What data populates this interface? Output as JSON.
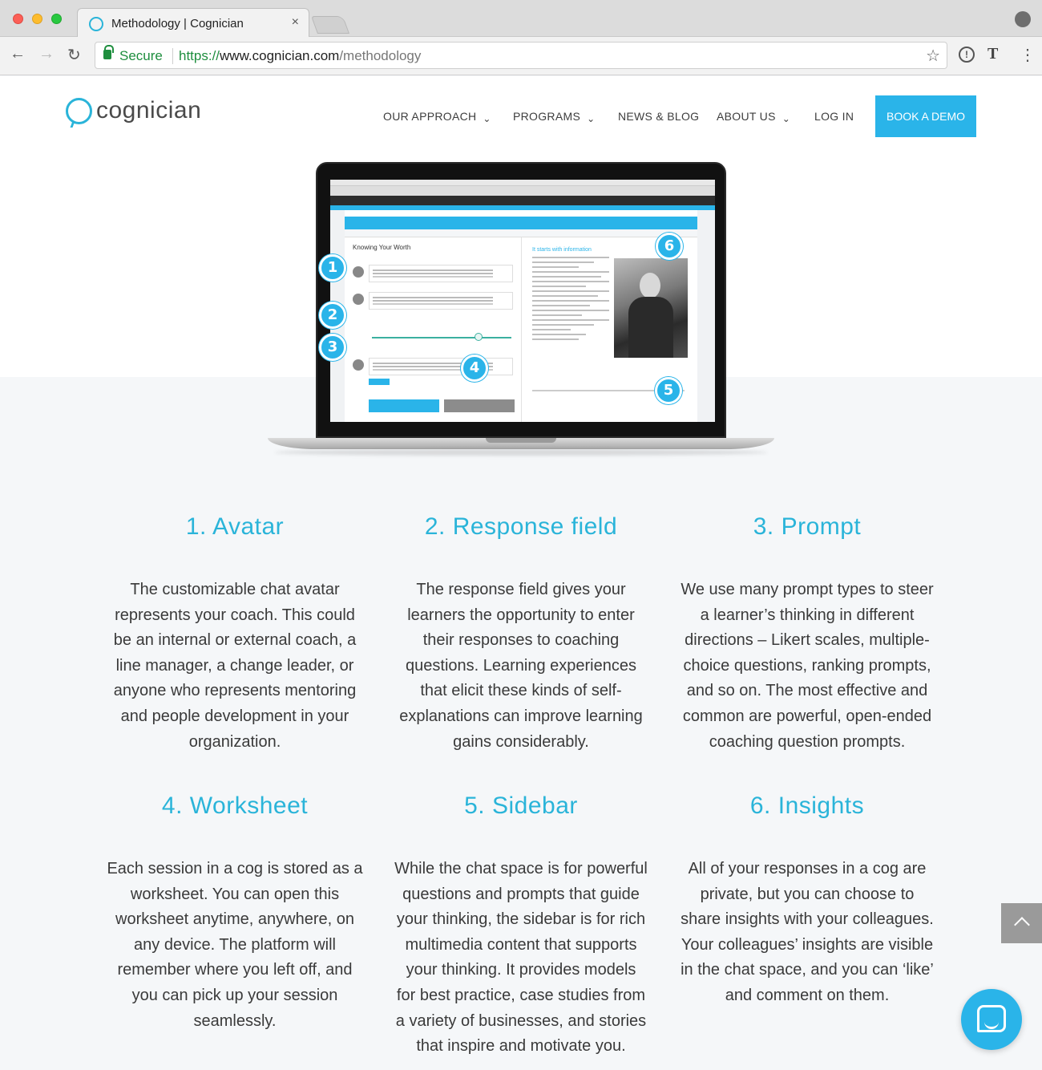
{
  "browser": {
    "tab_title": "Methodology | Cognician",
    "tab_close": "×",
    "secure_label": "Secure",
    "url_scheme": "https://",
    "url_host": "www.cognician.com",
    "url_path": "/methodology",
    "icons": [
      "back-icon",
      "forward-icon",
      "reload-icon",
      "lock-icon",
      "star-icon",
      "extension-icon",
      "menu-icon",
      "profile-icon"
    ]
  },
  "header": {
    "logo_text": "cognician",
    "nav": [
      {
        "label": "OUR APPROACH",
        "dropdown": true
      },
      {
        "label": "PROGRAMS",
        "dropdown": true
      },
      {
        "label": "NEWS & BLOG",
        "dropdown": false
      },
      {
        "label": "ABOUT US",
        "dropdown": true
      },
      {
        "label": "LOG IN",
        "dropdown": false
      }
    ],
    "cta": "BOOK A DEMO",
    "accent": "#2ab4e9"
  },
  "laptop": {
    "app_title": "Knowing Your Worth",
    "badges": [
      "1",
      "2",
      "3",
      "4",
      "5",
      "6"
    ],
    "right_title": "It starts with information"
  },
  "features": [
    {
      "title": "1. Avatar",
      "lines": [
        "The customizable chat avatar",
        "represents your coach. This could",
        "be an internal or external coach, a",
        "line manager, a change leader, or",
        "anyone who represents mentoring",
        "and people development in your",
        "organization."
      ]
    },
    {
      "title": "2. Response field",
      "lines": [
        "The response field gives your",
        "learners the opportunity to enter",
        "their responses to coaching",
        "questions. Learning experiences",
        "that elicit these kinds of self-",
        "explanations can improve learning",
        "gains considerably."
      ]
    },
    {
      "title": "3. Prompt",
      "lines": [
        "We use many prompt types to steer",
        "a learner’s thinking in different",
        "directions – Likert scales, multiple-",
        "choice questions, ranking prompts,",
        "and so on. The most effective and",
        "common are powerful, open-ended",
        "coaching question prompts."
      ]
    },
    {
      "title": "4. Worksheet",
      "lines": [
        "Each session in a cog is stored as a",
        "worksheet. You can open this",
        "worksheet anytime, anywhere, on",
        "any device. The platform will",
        "remember where you left off, and",
        "you can pick up your session",
        "seamlessly."
      ]
    },
    {
      "title": "5. Sidebar",
      "lines": [
        "While the chat space is for powerful",
        "questions and prompts that guide",
        "your thinking, the sidebar is for rich",
        "multimedia content that supports",
        "your thinking. It provides models",
        "for best practice, case studies from",
        "a variety of businesses, and stories",
        "that inspire and motivate you."
      ]
    },
    {
      "title": "6. Insights",
      "lines": [
        "All of your responses in a cog are",
        "private, but you can choose to",
        "share insights with your colleagues.",
        "Your colleagues’ insights are visible",
        "in the chat space, and you can ‘like’",
        "and comment on them."
      ]
    }
  ]
}
